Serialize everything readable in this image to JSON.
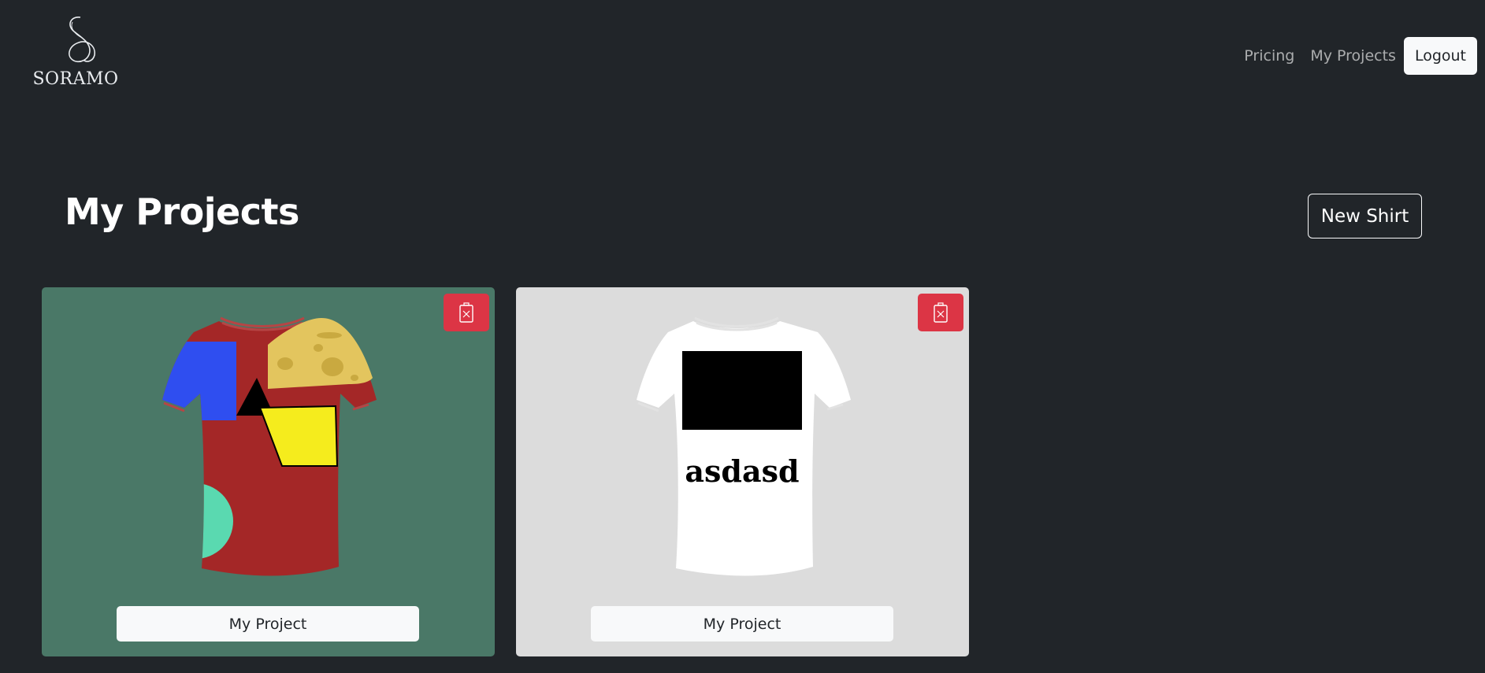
{
  "brand": {
    "name": "SORAMO"
  },
  "nav": {
    "links": [
      "Pricing",
      "My Projects"
    ],
    "logout_label": "Logout"
  },
  "page": {
    "title": "My Projects",
    "new_button_label": "New Shirt"
  },
  "projects": [
    {
      "name": "My Project",
      "background_color": "#4a7867",
      "shirt_color": "#a42727"
    },
    {
      "name": "My Project",
      "background_color": "#dcdcdc",
      "shirt_color": "#ffffff",
      "print_text": "asdasd"
    }
  ],
  "colors": {
    "danger": "#dc3545",
    "light": "#f8f9fa",
    "dark": "#212529"
  }
}
